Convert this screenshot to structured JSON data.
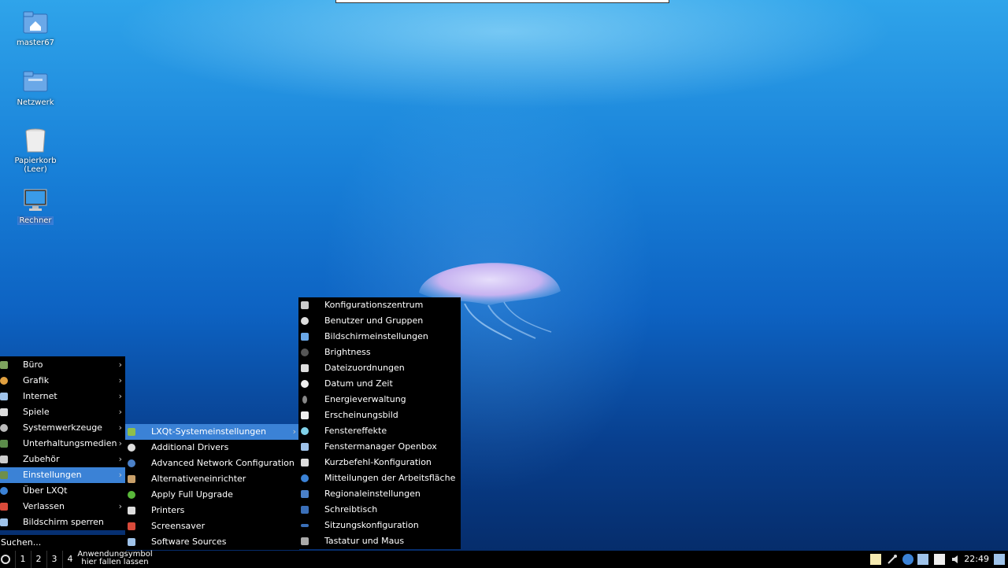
{
  "desktop": {
    "icons": [
      {
        "label": "master67",
        "icon": "home-folder-icon"
      },
      {
        "label": "Netzwerk",
        "icon": "network-folder-icon"
      },
      {
        "label": "Papierkorb\n(Leer)",
        "label1": "Papierkorb",
        "label2": "(Leer)",
        "icon": "trash-icon"
      },
      {
        "label": "Rechner",
        "icon": "computer-icon"
      }
    ]
  },
  "main_menu": {
    "items": [
      {
        "label": "Büro",
        "icon": "office-icon",
        "submenu": true
      },
      {
        "label": "Grafik",
        "icon": "graphics-icon",
        "submenu": true
      },
      {
        "label": "Internet",
        "icon": "internet-icon",
        "submenu": true
      },
      {
        "label": "Spiele",
        "icon": "games-icon",
        "submenu": true
      },
      {
        "label": "Systemwerkzeuge",
        "icon": "system-tools-icon",
        "submenu": true
      },
      {
        "label": "Unterhaltungsmedien",
        "icon": "multimedia-icon",
        "submenu": true
      },
      {
        "label": "Zubehör",
        "icon": "accessories-icon",
        "submenu": true
      },
      {
        "label": "Einstellungen",
        "icon": "settings-icon",
        "submenu": true,
        "active": true
      },
      {
        "label": "Über LXQt",
        "icon": "info-icon",
        "submenu": false
      },
      {
        "label": "Verlassen",
        "icon": "leave-icon",
        "submenu": true
      },
      {
        "label": "Bildschirm sperren",
        "icon": "lock-screen-icon",
        "submenu": false
      }
    ],
    "search_placeholder": "Suchen..."
  },
  "settings_menu": {
    "items": [
      {
        "label": "LXQt-Systemeinstellungen",
        "icon": "lxqt-settings-icon",
        "submenu": true,
        "active": true
      },
      {
        "label": "Additional Drivers",
        "icon": "drivers-icon"
      },
      {
        "label": "Advanced Network Configuration",
        "icon": "network-config-icon"
      },
      {
        "label": "Alternativeneinrichter",
        "icon": "alternatives-icon"
      },
      {
        "label": "Apply Full Upgrade",
        "icon": "upgrade-icon"
      },
      {
        "label": "Printers",
        "icon": "printer-icon"
      },
      {
        "label": "Screensaver",
        "icon": "screensaver-icon"
      },
      {
        "label": "Software Sources",
        "icon": "software-sources-icon"
      }
    ]
  },
  "lxqt_menu": {
    "items": [
      {
        "label": "Konfigurationszentrum",
        "icon": "config-center-icon"
      },
      {
        "label": "Benutzer und Gruppen",
        "icon": "users-icon"
      },
      {
        "label": "Bildschirmeinstellungen",
        "icon": "monitor-icon"
      },
      {
        "label": "Brightness",
        "icon": "brightness-icon"
      },
      {
        "label": "Dateizuordnungen",
        "icon": "file-associations-icon"
      },
      {
        "label": "Datum und Zeit",
        "icon": "clock-icon"
      },
      {
        "label": "Energieverwaltung",
        "icon": "power-icon"
      },
      {
        "label": "Erscheinungsbild",
        "icon": "appearance-icon"
      },
      {
        "label": "Fenstereffekte",
        "icon": "window-effects-icon"
      },
      {
        "label": "Fenstermanager Openbox",
        "icon": "openbox-icon"
      },
      {
        "label": "Kurzbefehl-Konfiguration",
        "icon": "keyboard-shortcut-icon"
      },
      {
        "label": "Mitteilungen der Arbeitsfläche",
        "icon": "notification-icon"
      },
      {
        "label": "Regionaleinstellungen",
        "icon": "region-icon"
      },
      {
        "label": "Schreibtisch",
        "icon": "desktop-icon"
      },
      {
        "label": "Sitzungskonfiguration",
        "icon": "session-icon"
      },
      {
        "label": "Tastatur und Maus",
        "icon": "keyboard-mouse-icon"
      }
    ]
  },
  "taskbar": {
    "workspaces": [
      "1",
      "2",
      "3",
      "4"
    ],
    "task_hint_line1": "Anwendungsymbol",
    "task_hint_line2": "hier fallen lassen",
    "clock": "22:49",
    "tray_icons": [
      "clipboard-icon",
      "tools-icon",
      "update-icon",
      "network-icon",
      "window-icon",
      "volume-icon",
      "show-desktop-icon"
    ]
  },
  "colors": {
    "menu_bg": "#000000",
    "highlight": "#3b82d6",
    "text": "#ffffff"
  }
}
